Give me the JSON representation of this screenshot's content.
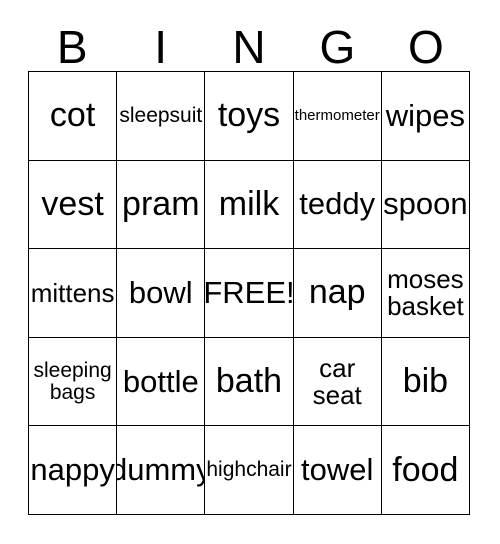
{
  "card": {
    "type": "bingo-card",
    "theme": "baby-items",
    "columns": 5,
    "rows": 5,
    "background_color": "#ffffff",
    "text_color": "#000000",
    "border_color": "#000000"
  },
  "header": {
    "letters": [
      "B",
      "I",
      "N",
      "G",
      "O"
    ]
  },
  "grid": {
    "free_space": "FREE!",
    "free_space_position": {
      "row": 3,
      "col": 3
    },
    "rows": [
      [
        {
          "text": "cot",
          "size": "fs-xl"
        },
        {
          "text": "sleepsuit",
          "size": "fs-sm"
        },
        {
          "text": "toys",
          "size": "fs-xl"
        },
        {
          "text": "thermometer",
          "size": "fs-xs"
        },
        {
          "text": "wipes",
          "size": "fs-lg"
        }
      ],
      [
        {
          "text": "vest",
          "size": "fs-xl"
        },
        {
          "text": "pram",
          "size": "fs-xl"
        },
        {
          "text": "milk",
          "size": "fs-xl"
        },
        {
          "text": "teddy",
          "size": "fs-lg"
        },
        {
          "text": "spoon",
          "size": "fs-lg"
        }
      ],
      [
        {
          "text": "mittens",
          "size": "fs-md"
        },
        {
          "text": "bowl",
          "size": "fs-lg"
        },
        {
          "text": "FREE!",
          "size": "fs-lg"
        },
        {
          "text": "nap",
          "size": "fs-xl"
        },
        {
          "text": "moses\nbasket",
          "size": "fs-md"
        }
      ],
      [
        {
          "text": "sleeping\nbags",
          "size": "fs-sm"
        },
        {
          "text": "bottle",
          "size": "fs-lg"
        },
        {
          "text": "bath",
          "size": "fs-xl"
        },
        {
          "text": "car\nseat",
          "size": "fs-md"
        },
        {
          "text": "bib",
          "size": "fs-xl"
        }
      ],
      [
        {
          "text": "nappy",
          "size": "fs-lg"
        },
        {
          "text": "dummy",
          "size": "fs-lg"
        },
        {
          "text": "highchair",
          "size": "fs-sm"
        },
        {
          "text": "towel",
          "size": "fs-lg"
        },
        {
          "text": "food",
          "size": "fs-xl"
        }
      ]
    ]
  }
}
